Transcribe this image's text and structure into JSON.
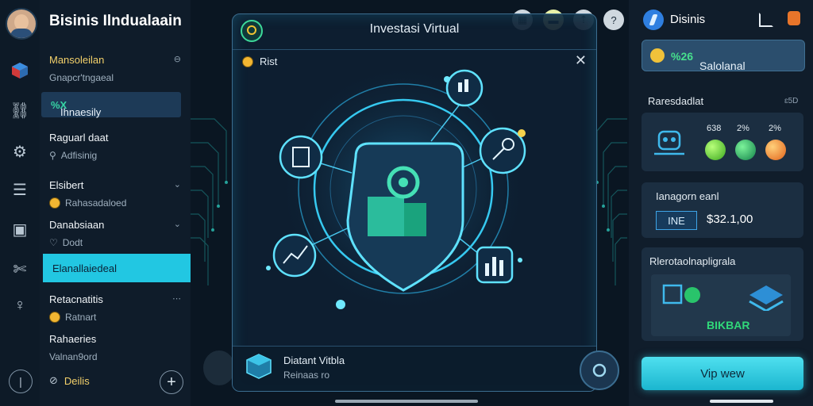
{
  "left_panel": {
    "title": "Bisinis Ilndualaain",
    "items": [
      {
        "head": "Mansoleilan",
        "sub": "Gnapcr'tngaeal"
      },
      {
        "selected": "Ihnaesily",
        "selected_accent": "%X"
      },
      {
        "head": "Raguarl daat",
        "sub": "Adfisinig"
      },
      {
        "head": "Elsibert",
        "sub": "Rahasadaloed"
      },
      {
        "head": "Danabsiaan",
        "sub": "Dodt"
      },
      {
        "active": "Elanallaiedeal"
      },
      {
        "head": "Retacnatitis",
        "sub": "Ratnart"
      },
      {
        "head": "Rahaeries",
        "sub": "Valnan9ord"
      },
      {
        "head": "Deilis"
      }
    ]
  },
  "dialog": {
    "title": "Investasi Virtual",
    "badge": "Rist",
    "footer_title": "Diatant Vitbla",
    "footer_sub": "Reinaas ro"
  },
  "right_panel": {
    "title": "Disinis",
    "balance_label": "Salolanal",
    "balance_value": "%26",
    "stats_label": "Raresdadlat",
    "stats_right": "ɛ5D",
    "stats": [
      "638",
      "2%",
      "2%"
    ],
    "invest_label": "Ianagorn eanl",
    "invest_tag": "INE",
    "invest_amount": "$32.1,00",
    "recommend_label": "Rlerotaolnapligrala",
    "recommend_brand": "BIKBAR",
    "cta": "Vip wew"
  },
  "colors": {
    "accent_cyan": "#22c7e2",
    "accent_green": "#37d4a5",
    "panel_bg": "#0f1c2a"
  }
}
